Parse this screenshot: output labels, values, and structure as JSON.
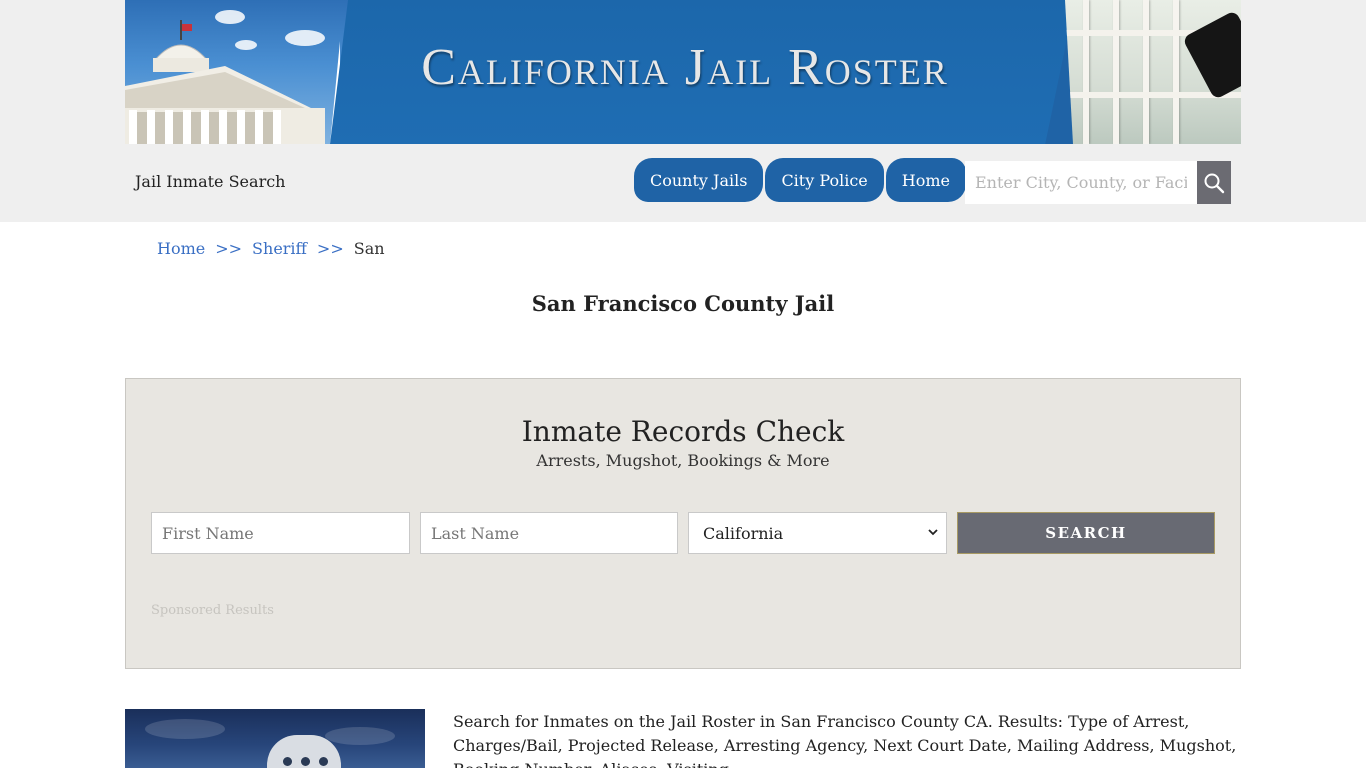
{
  "banner": {
    "title": "California Jail Roster"
  },
  "header": {
    "site_name": "Jail Inmate Search",
    "nav": [
      "County Jails",
      "City Police",
      "Home"
    ],
    "search_placeholder": "Enter City, County, or Facility"
  },
  "breadcrumb": {
    "items": [
      "Home",
      "Sheriff"
    ],
    "separator": ">>",
    "current": "San"
  },
  "page_title": "San Francisco County Jail",
  "records": {
    "title": "Inmate Records Check",
    "subtitle": "Arrests, Mugshot, Bookings & More",
    "first_name_placeholder": "First Name",
    "last_name_placeholder": "Last Name",
    "state_selected": "California",
    "search_label": "SEARCH",
    "sponsored": "Sponsored Results"
  },
  "intro": "Search for Inmates on the Jail Roster in San Francisco County CA. Results: Type of Arrest, Charges/Bail, Projected Release, Arresting Agency, Next Court Date, Mailing Address, Mugshot, Booking Number, Aliases, Visiting...",
  "colors": {
    "brand_blue": "#1f63a6",
    "panel_bg": "#e8e6e1",
    "link": "#3a6fc4",
    "button_grey": "#686a73"
  },
  "icons": {
    "search": "magnifier-icon",
    "select_caret": "chevron-down-icon"
  }
}
